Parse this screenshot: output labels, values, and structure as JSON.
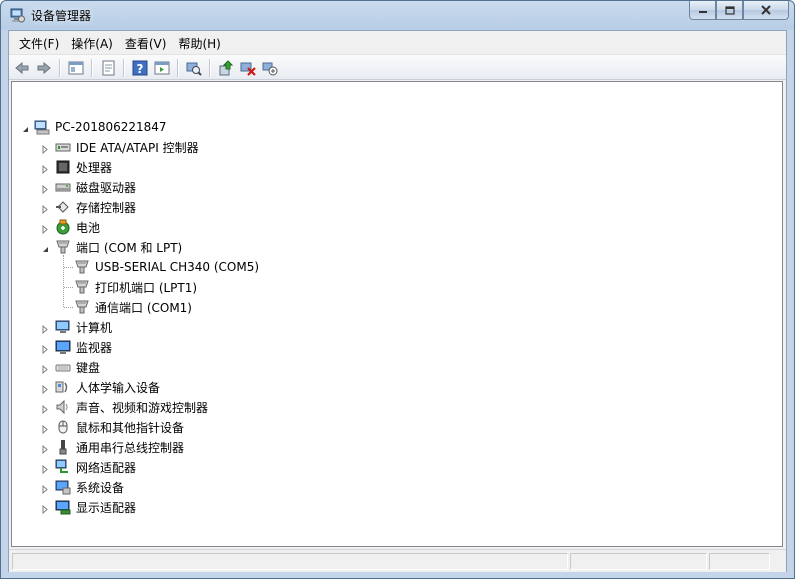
{
  "window": {
    "title": "设备管理器"
  },
  "menu": [
    "文件(F)",
    "操作(A)",
    "查看(V)",
    "帮助(H)"
  ],
  "toolbar": {
    "buttons": [
      "back-icon",
      "forward-icon",
      "show-hide-console-tree-icon",
      "properties-icon",
      "help-icon",
      "show-hide-action-pane-icon",
      "scan-hardware-icon",
      "update-driver-icon",
      "uninstall-icon",
      "disable-device-icon"
    ]
  },
  "tree": {
    "root": {
      "label": "PC-201806221847",
      "icon": "computer-icon"
    },
    "categories": [
      {
        "label": "IDE ATA/ATAPI 控制器",
        "icon": "ide-controller-icon",
        "expanded": false
      },
      {
        "label": "处理器",
        "icon": "processor-icon",
        "expanded": false
      },
      {
        "label": "磁盘驱动器",
        "icon": "disk-drive-icon",
        "expanded": false
      },
      {
        "label": "存储控制器",
        "icon": "storage-controller-icon",
        "expanded": false
      },
      {
        "label": "电池",
        "icon": "battery-icon",
        "expanded": false
      },
      {
        "label": "端口 (COM 和 LPT)",
        "icon": "port-icon",
        "expanded": true,
        "children": [
          {
            "label": "USB-SERIAL CH340 (COM5)",
            "icon": "port-icon"
          },
          {
            "label": "打印机端口 (LPT1)",
            "icon": "port-icon"
          },
          {
            "label": "通信端口 (COM1)",
            "icon": "port-icon"
          }
        ]
      },
      {
        "label": "计算机",
        "icon": "computer-icon",
        "expanded": false
      },
      {
        "label": "监视器",
        "icon": "monitor-icon",
        "expanded": false
      },
      {
        "label": "键盘",
        "icon": "keyboard-icon",
        "expanded": false
      },
      {
        "label": "人体学输入设备",
        "icon": "hid-icon",
        "expanded": false
      },
      {
        "label": "声音、视频和游戏控制器",
        "icon": "speaker-icon",
        "expanded": false
      },
      {
        "label": "鼠标和其他指针设备",
        "icon": "mouse-icon",
        "expanded": false
      },
      {
        "label": "通用串行总线控制器",
        "icon": "usb-icon",
        "expanded": false
      },
      {
        "label": "网络适配器",
        "icon": "network-adapter-icon",
        "expanded": false
      },
      {
        "label": "系统设备",
        "icon": "system-device-icon",
        "expanded": false
      },
      {
        "label": "显示适配器",
        "icon": "display-adapter-icon",
        "expanded": false
      }
    ]
  }
}
